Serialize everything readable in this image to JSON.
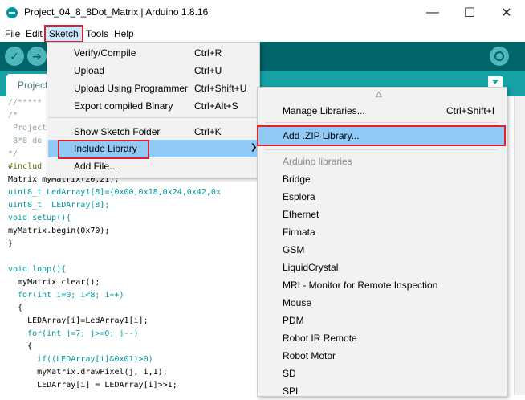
{
  "window": {
    "title": "Project_04_8_8Dot_Matrix | Arduino 1.8.16",
    "minimize": "—",
    "maximize": "☐",
    "close": "✕"
  },
  "menubar": [
    "File",
    "Edit",
    "Sketch",
    "Tools",
    "Help"
  ],
  "toolbar": {
    "verify_icon": "✓",
    "upload_icon": "➔"
  },
  "tab": {
    "label": "Project"
  },
  "code_lines": [
    "//*****",
    "/*",
    " Project",
    " 8*8 do",
    "*/",
    "#includ",
    "Matrix myMatrix(20,21);",
    "uint8_t LedArray1[8]={0x00,0x18,0x24,0x42,0x",
    "uint8_t  LEDArray[8];",
    "void setup(){",
    "myMatrix.begin(0x70);",
    "}",
    "",
    "void loop(){",
    "  myMatrix.clear();",
    "  for(int i=0; i<8; i++)",
    "  {",
    "    LEDArray[i]=LedArray1[i];",
    "    for(int j=7; j>=0; j--)",
    "    {",
    "      if((LEDArray[i]&0x01)>0)",
    "      myMatrix.drawPixel(j, i,1);",
    "      LEDArray[i] = LEDArray[i]>>1;"
  ],
  "sketch_menu": [
    {
      "label": "Verify/Compile",
      "shortcut": "Ctrl+R"
    },
    {
      "label": "Upload",
      "shortcut": "Ctrl+U"
    },
    {
      "label": "Upload Using Programmer",
      "shortcut": "Ctrl+Shift+U"
    },
    {
      "label": "Export compiled Binary",
      "shortcut": "Ctrl+Alt+S"
    },
    {
      "label": "Show Sketch Folder",
      "shortcut": "Ctrl+K"
    },
    {
      "label": "Include Library",
      "shortcut": ""
    },
    {
      "label": "Add File...",
      "shortcut": ""
    }
  ],
  "library_menu": {
    "scroll_up": "△",
    "manage": {
      "label": "Manage Libraries...",
      "shortcut": "Ctrl+Shift+I"
    },
    "add_zip": "Add .ZIP Library...",
    "header": "Arduino libraries",
    "libraries": [
      "Bridge",
      "Esplora",
      "Ethernet",
      "Firmata",
      "GSM",
      "LiquidCrystal",
      "MRI - Monitor for Remote Inspection",
      "Mouse",
      "PDM",
      "Robot IR Remote",
      "Robot Motor",
      "SD",
      "SPI"
    ]
  },
  "colors": {
    "accent_teal": "#006468",
    "tab_teal": "#17a1a5",
    "highlight": "#91c9f7",
    "annotation_red": "#e0202a"
  }
}
